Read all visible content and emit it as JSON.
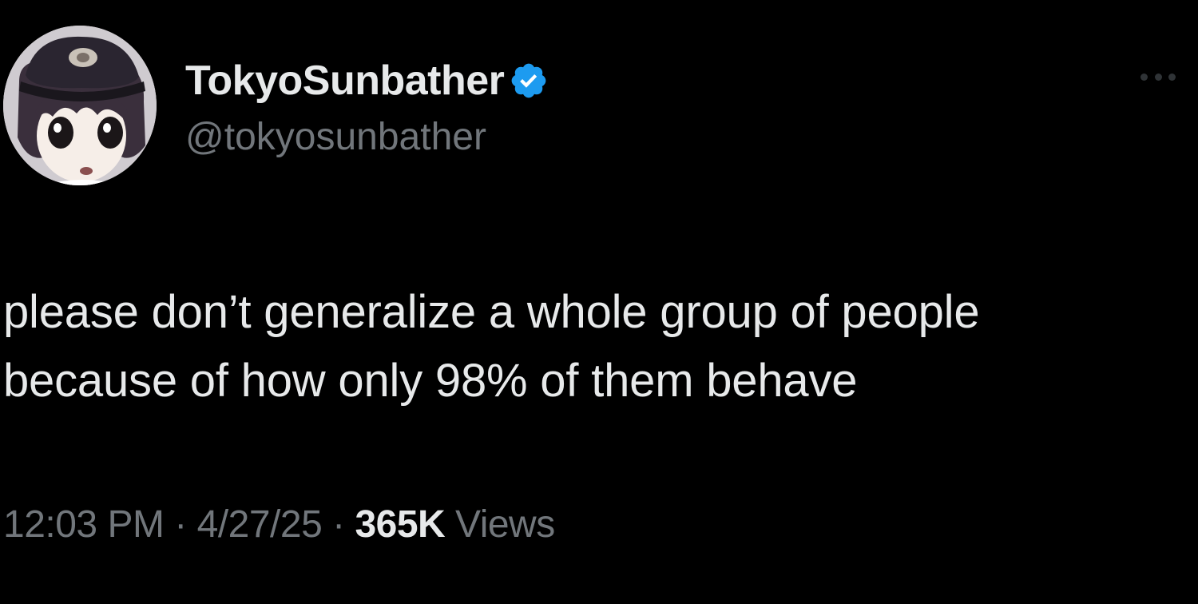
{
  "tweet": {
    "display_name": "TokyoSunbather",
    "handle": "@tokyosunbather",
    "verified": true,
    "text_lines": [
      "please don’t generalize a whole group of people",
      "because of how only 98% of them behave"
    ],
    "time": "12:03 PM",
    "separator": "·",
    "date": "4/27/25",
    "views_count": "365K",
    "views_label": "Views"
  },
  "icons": {
    "verified": "verified-badge-icon",
    "more": "more-options-icon"
  },
  "colors": {
    "background": "#000000",
    "text": "#e7e9ea",
    "secondary_text": "#71767b",
    "verified_blue": "#1d9bf0"
  }
}
